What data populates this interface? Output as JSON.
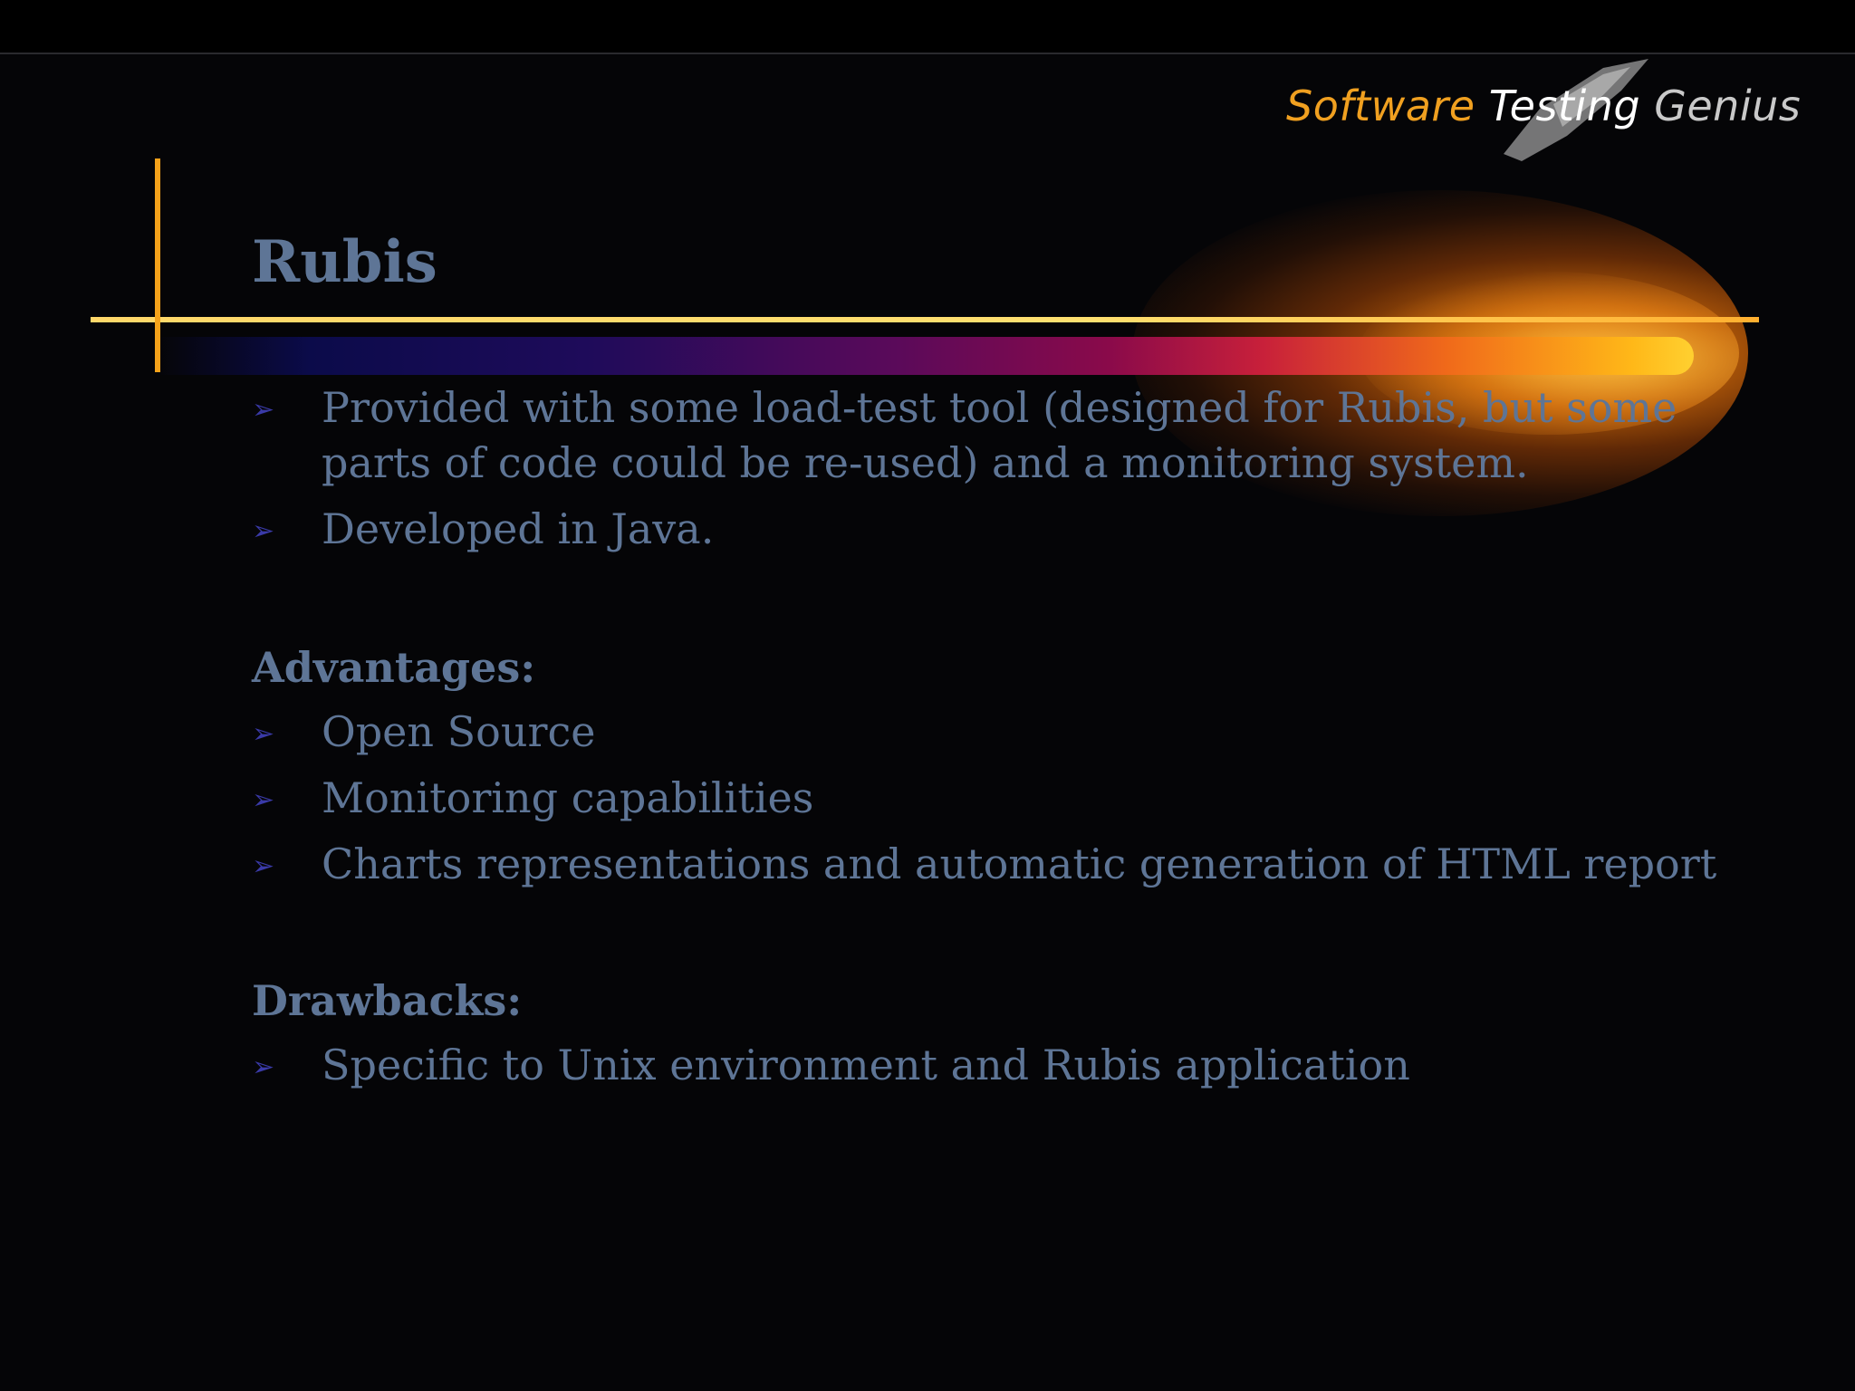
{
  "logo": {
    "word1": "Software",
    "word2": "Testing",
    "word3": "Genius"
  },
  "slide": {
    "title": "Rubis",
    "intro_bullets": [
      "Provided with some load-test tool (designed for Rubis, but some parts of code could be re-used) and a monitoring system.",
      "Developed in Java."
    ],
    "advantages": {
      "heading": "Advantages:",
      "items": [
        "Open Source",
        "Monitoring capabilities",
        "Charts representations and automatic generation of HTML report"
      ]
    },
    "drawbacks": {
      "heading": "Drawbacks:",
      "items": [
        "Specific to Unix environment and Rubis application"
      ]
    }
  },
  "icons": {
    "bullet": "arrow-bullet-icon"
  },
  "colors": {
    "background": "#050507",
    "text": "#5e7596",
    "accent_orange": "#f5a21a",
    "accent_line": "#ffd86a",
    "bullet": "#3a3aa8"
  }
}
